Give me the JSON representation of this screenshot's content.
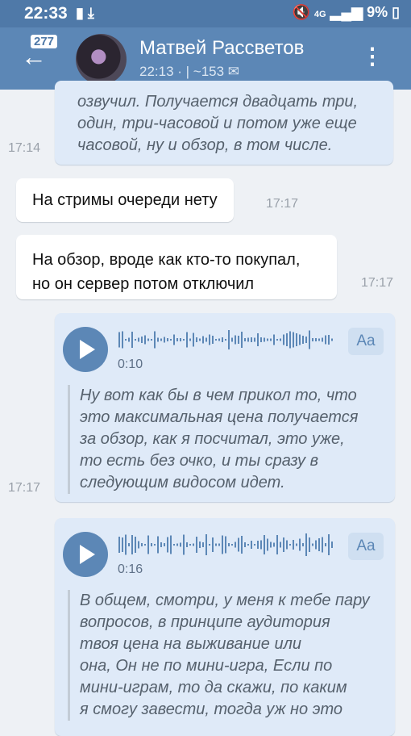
{
  "statusbar": {
    "time": "22:33",
    "battery": "9%",
    "network": "4G"
  },
  "header": {
    "unread_badge": "277",
    "title": "Матвей Рассветов",
    "subtitle": "22:13 · | ~153 ✉"
  },
  "messages": [
    {
      "type": "out-text",
      "text_lines": [
        "озвучил. Получается двадцать три,",
        "один, три-часовой и потом уже еще",
        "часовой, ну и обзор, в том числе."
      ],
      "time": "17:14"
    },
    {
      "type": "in-text",
      "text": "На стримы очереди нету",
      "time": "17:17"
    },
    {
      "type": "in-text",
      "text_lines": [
        "На обзор, вроде как кто-то покупал,",
        "но он сервер потом отключил"
      ],
      "time": "17:17"
    },
    {
      "type": "out-voice",
      "duration": "0:10",
      "transcript_button": "Aa",
      "transcript_lines": [
        "Ну вот как бы в чем прикол то, что",
        "это максимальная цена получается",
        "за обзор, как я посчитал, это уже,",
        "то есть без очко, и ты сразу в",
        "следующим видосом идет."
      ],
      "time": "17:17"
    },
    {
      "type": "out-voice",
      "duration": "0:16",
      "transcript_button": "Aa",
      "transcript_lines": [
        "В общем, смотри, у меня к тебе пару",
        "вопросов, в принципе аудитория",
        "твоя цена на выживание или",
        "она, Он не по мини-игра, Если по",
        "мини-играм, то да скажи, по каким",
        "я смогу завести, тогда уж но это"
      ]
    }
  ],
  "colors": {
    "header": "#5c87b6",
    "statusbar": "#4f79a8",
    "outgoing": "#dfeaf8",
    "incoming": "#ffffff",
    "background": "#eef1f5"
  },
  "icons": [
    "back-arrow-icon",
    "android-icon",
    "mail-icon",
    "more-vert-icon",
    "play-icon",
    "waveform-icon"
  ]
}
